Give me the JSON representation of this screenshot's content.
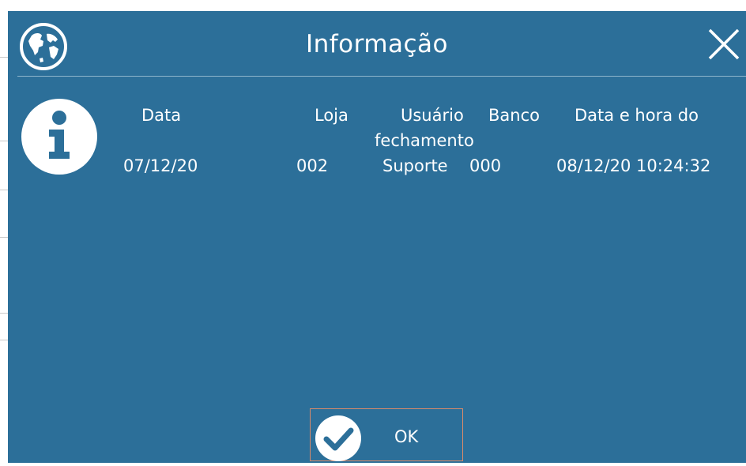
{
  "dialog": {
    "title": "Informação",
    "icons": {
      "app": "globe-icon",
      "close": "close-icon",
      "message": "info-icon",
      "ok": "check-icon"
    }
  },
  "message": {
    "headers": {
      "data": "Data",
      "loja": "Loja",
      "usuario": "Usuário",
      "banco": "Banco",
      "data_hora": "Data e hora do",
      "data_hora_cont": "fechamento"
    },
    "values": {
      "data": "07/12/20",
      "loja": "002",
      "usuario": "Suporte",
      "banco": "000",
      "data_hora": "08/12/20 10:24:32"
    }
  },
  "ok_button": {
    "label": "OK"
  },
  "colors": {
    "dialog_bg": "#2c6f99",
    "text": "#ffffff",
    "ok_border": "#d98a6a"
  }
}
